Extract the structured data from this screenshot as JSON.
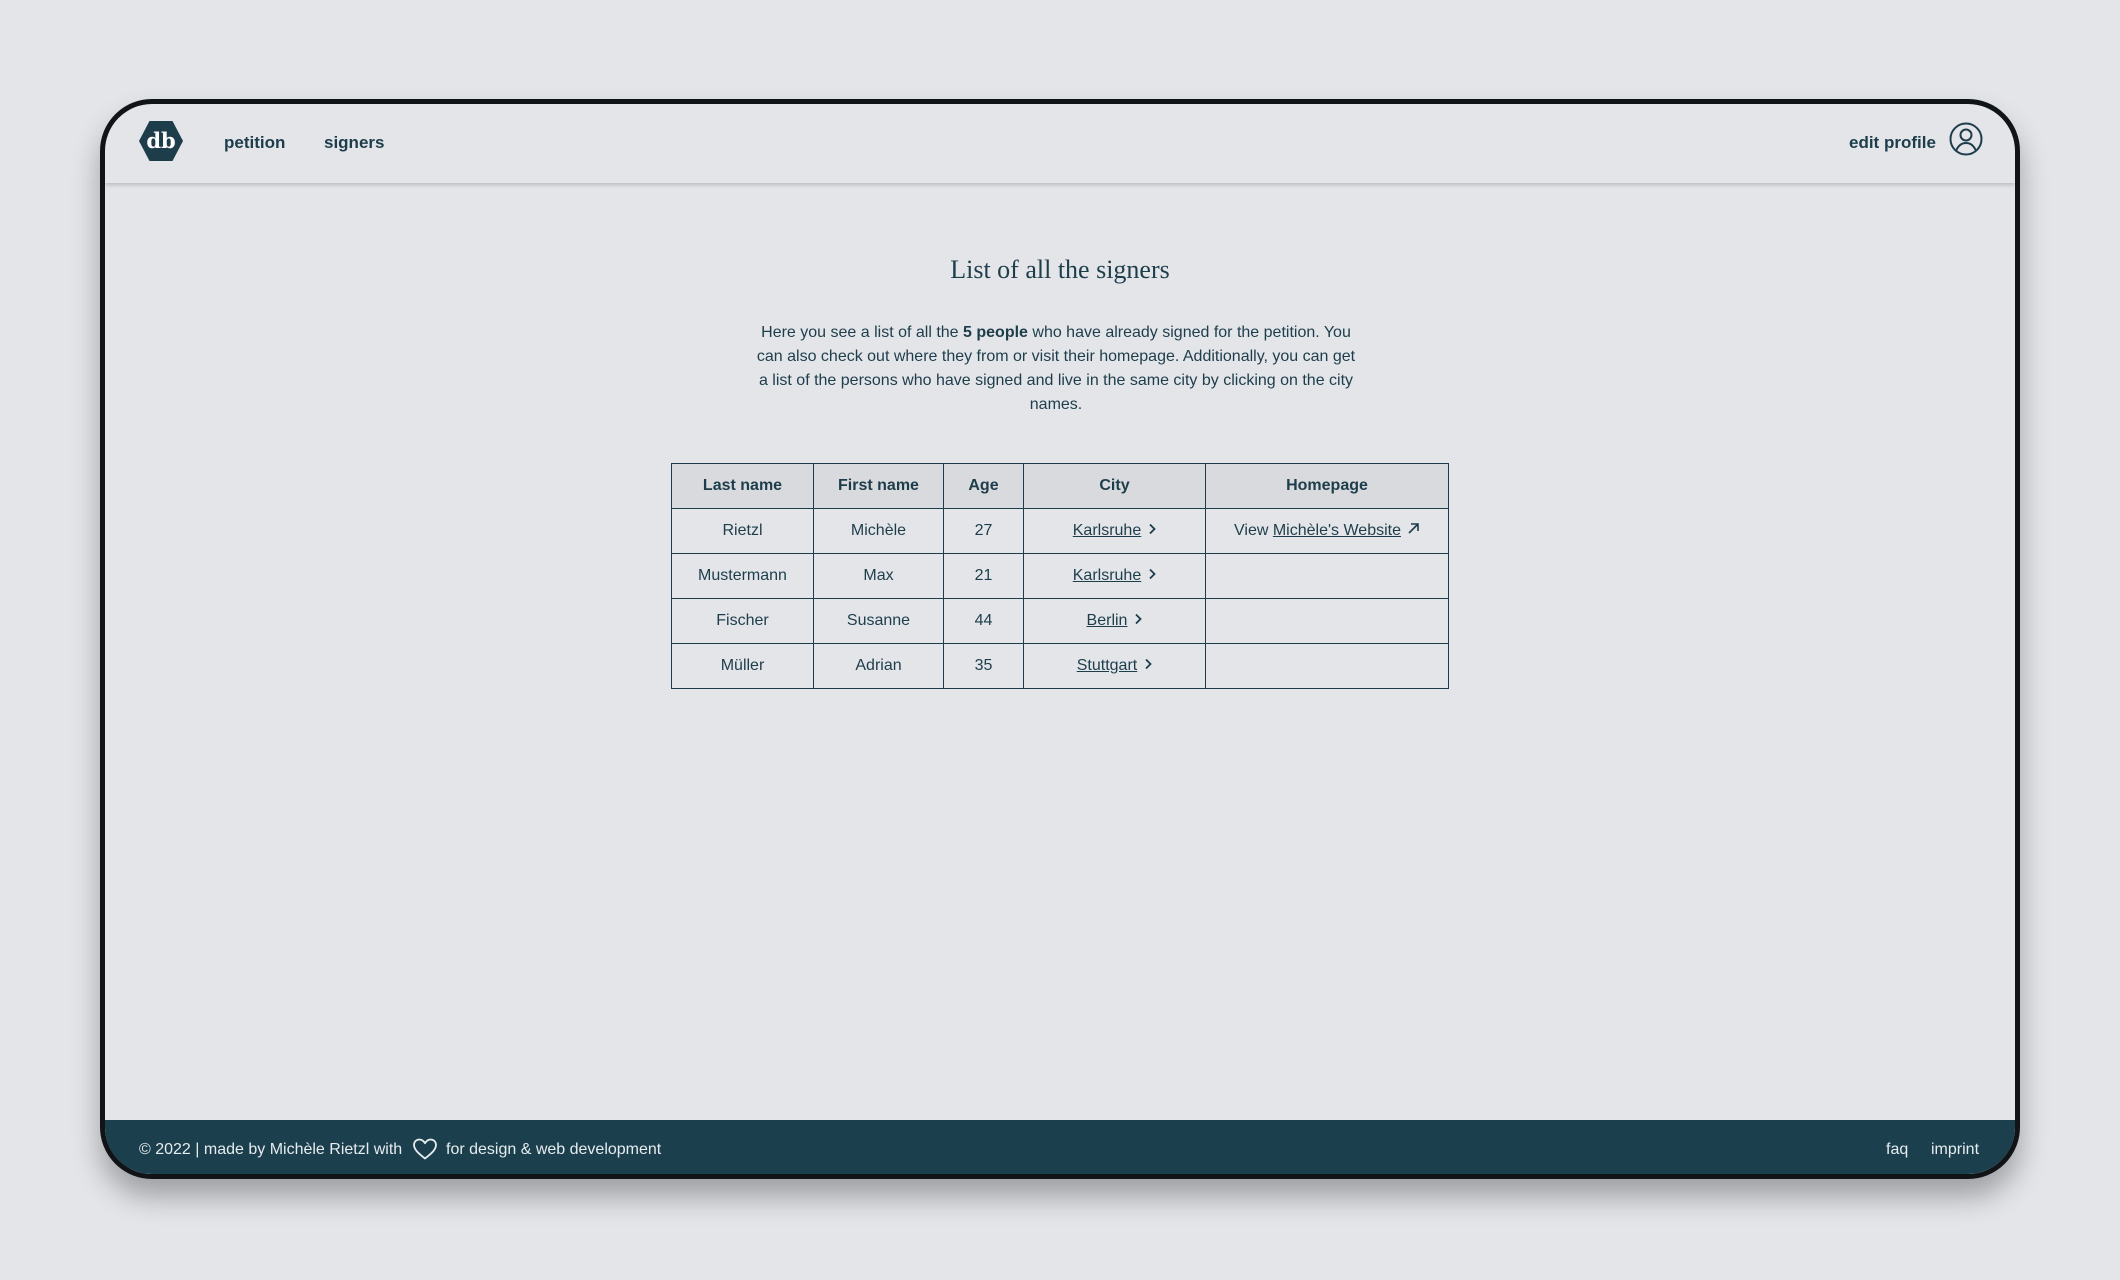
{
  "nav": {
    "logo_text": "db",
    "items": [
      {
        "label": "petition"
      },
      {
        "label": "signers"
      }
    ],
    "edit_profile": "edit profile"
  },
  "main": {
    "title": "List of all the signers",
    "intro_before": "Here you see a list of all the ",
    "intro_bold": "5 people",
    "intro_after": " who have already signed for the petition. You can also check out where they from or visit their homepage. Additionally, you can get a list of the persons who have signed and live in the same city by clicking on the city names."
  },
  "table": {
    "headers": [
      "Last name",
      "First name",
      "Age",
      "City",
      "Homepage"
    ],
    "rows": [
      {
        "last": "Rietzl",
        "first": "Michèle",
        "age": "27",
        "city": "Karlsruhe",
        "home_prefix": "View ",
        "home_link": "Michèle's Website"
      },
      {
        "last": "Mustermann",
        "first": "Max",
        "age": "21",
        "city": "Karlsruhe",
        "home_prefix": "",
        "home_link": ""
      },
      {
        "last": "Fischer",
        "first": "Susanne",
        "age": "44",
        "city": "Berlin",
        "home_prefix": "",
        "home_link": ""
      },
      {
        "last": "Müller",
        "first": "Adrian",
        "age": "35",
        "city": "Stuttgart",
        "home_prefix": "",
        "home_link": ""
      }
    ]
  },
  "footer": {
    "copyright": "© 2022 | made by Michèle Rietzl with",
    "suffix": "for design & web development",
    "links": [
      {
        "label": "faq"
      },
      {
        "label": "imprint"
      }
    ]
  },
  "colors": {
    "background": "#e3e5e9",
    "primary": "#1e3d4b",
    "footer_bg": "#1c3f4d",
    "header_cell_bg": "#d8dadd"
  },
  "icons": {
    "logo": "hexagon-logo-icon",
    "profile": "user-circle-icon",
    "city_link": "chevron-right-icon",
    "homepage": "external-link-arrow-icon",
    "footer": "heart-icon"
  }
}
